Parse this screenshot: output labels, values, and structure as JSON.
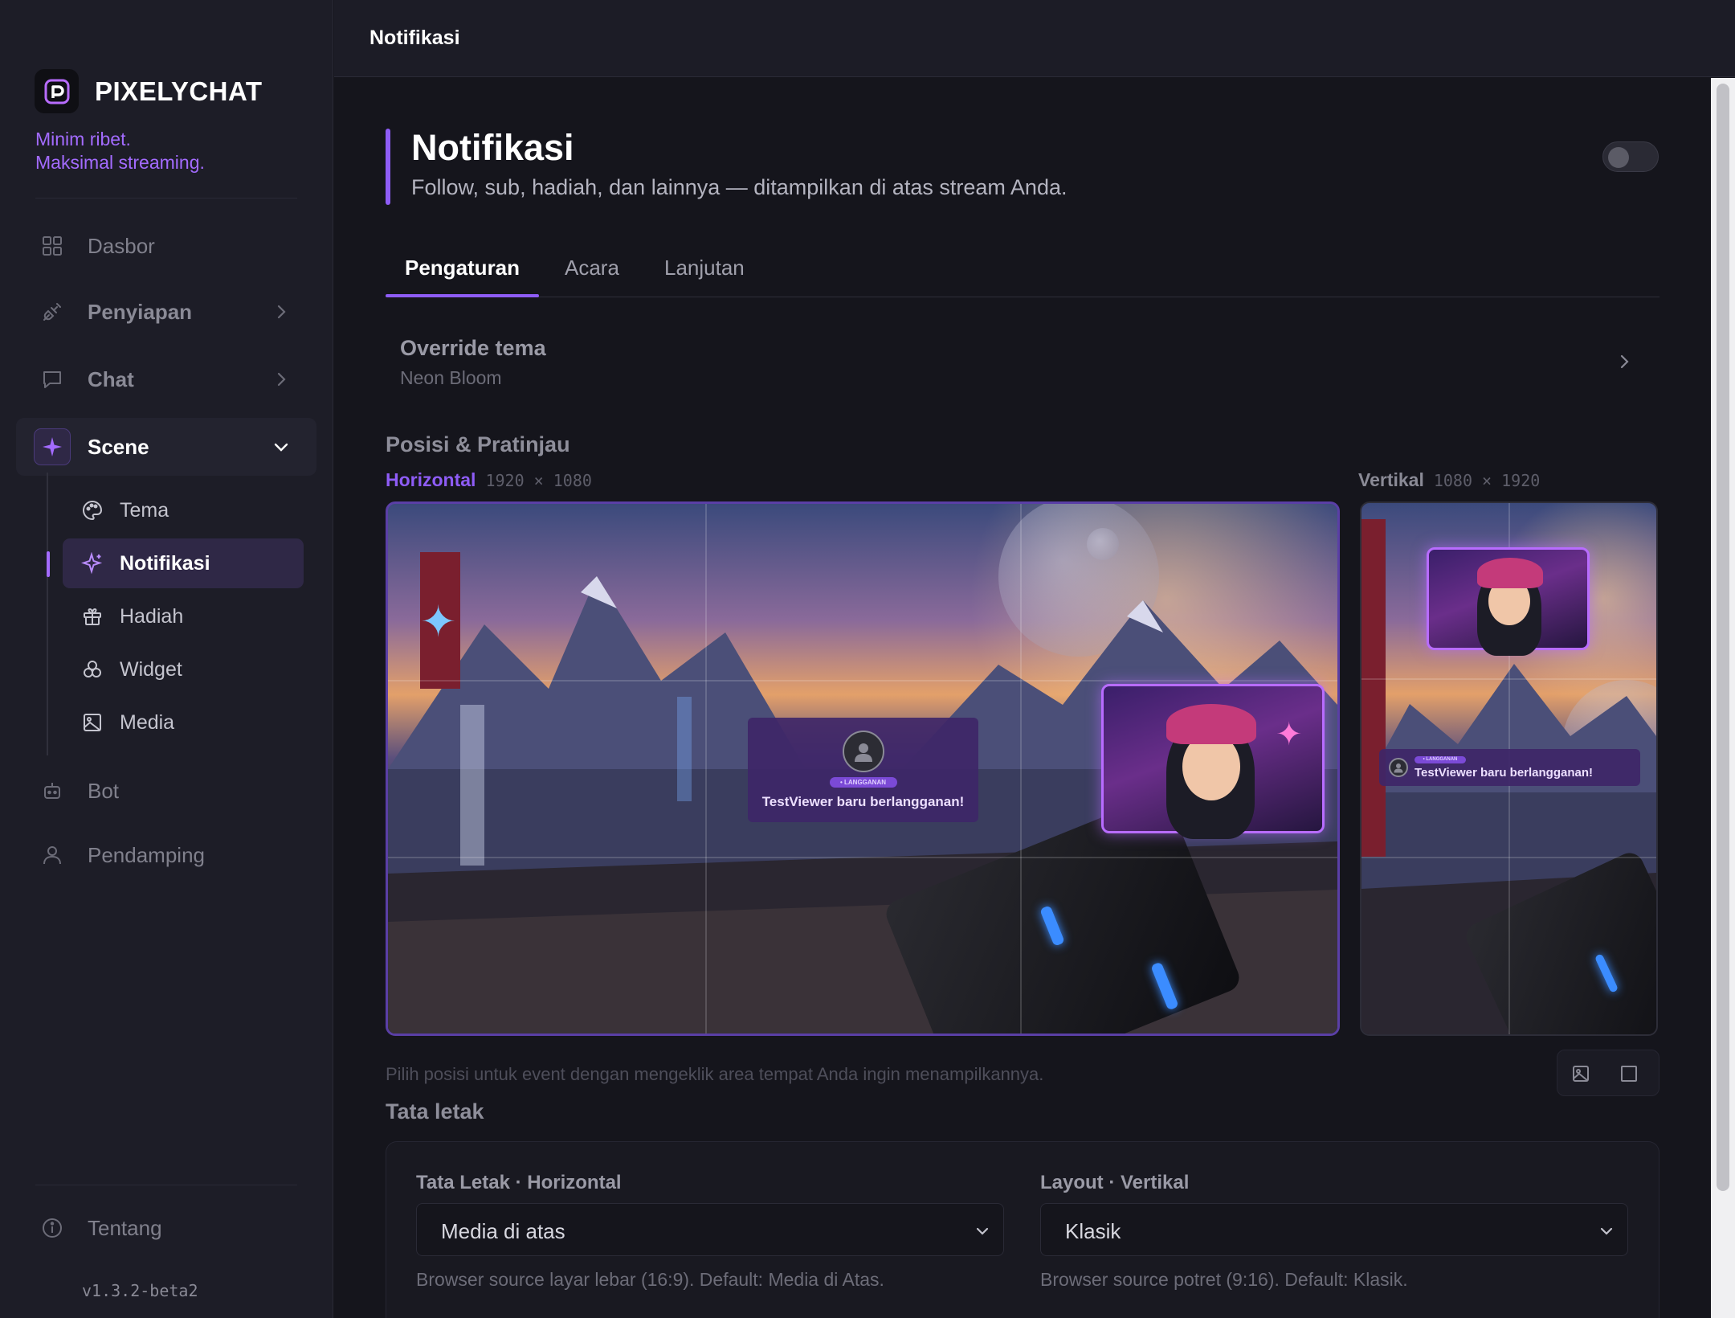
{
  "brand": {
    "name": "PIXELYCHAT",
    "tagline_line1": "Minim ribet.",
    "tagline_line2": "Maksimal streaming."
  },
  "sidebar": {
    "items": [
      {
        "label": "Dasbor",
        "icon": "grid-icon"
      },
      {
        "label": "Penyiapan",
        "icon": "plug-icon"
      },
      {
        "label": "Chat",
        "icon": "chat-bubble-icon"
      },
      {
        "label": "Scene",
        "icon": "sparkle-icon",
        "expanded": true
      },
      {
        "label": "Bot",
        "icon": "robot-icon"
      },
      {
        "label": "Pendamping",
        "icon": "user-icon"
      }
    ],
    "scene_subitems": [
      {
        "label": "Tema",
        "icon": "palette-icon"
      },
      {
        "label": "Notifikasi",
        "icon": "sparkle-icon",
        "active": true
      },
      {
        "label": "Hadiah",
        "icon": "gift-icon"
      },
      {
        "label": "Widget",
        "icon": "widget-icon"
      },
      {
        "label": "Media",
        "icon": "image-icon"
      }
    ],
    "about_label": "Tentang",
    "version": "v1.3.2-beta2"
  },
  "topbar": {
    "title": "Notifikasi"
  },
  "page": {
    "title": "Notifikasi",
    "subtitle": "Follow, sub, hadiah, dan lainnya — ditampilkan di atas stream Anda.",
    "enabled": false
  },
  "tabs": [
    {
      "label": "Pengaturan",
      "active": true
    },
    {
      "label": "Acara",
      "active": false
    },
    {
      "label": "Lanjutan",
      "active": false
    }
  ],
  "override": {
    "title": "Override tema",
    "value": "Neon Bloom"
  },
  "preview": {
    "section_title": "Posisi & Pratinjau",
    "horizontal_label": "Horizontal",
    "horizontal_dims": "1920 × 1080",
    "vertical_label": "Vertikal",
    "vertical_dims": "1080 × 1920",
    "notification_text": "TestViewer baru berlangganan!",
    "notification_badge": "• LANGGANAN",
    "hint": "Pilih posisi untuk event dengan mengeklik area tempat Anda ingin menampilkannya."
  },
  "layout": {
    "section_title": "Tata letak",
    "horizontal": {
      "label": "Tata Letak · Horizontal",
      "value": "Media di atas",
      "help": "Browser source layar lebar (16:9). Default: Media di Atas."
    },
    "vertical": {
      "label": "Layout · Vertikal",
      "value": "Klasik",
      "help": "Browser source potret (9:16). Default: Klasik."
    }
  },
  "colors": {
    "accent": "#8e5cf6",
    "accent_text": "#a36bff",
    "background": "#15151c",
    "sidebar": "#1d1d27"
  }
}
